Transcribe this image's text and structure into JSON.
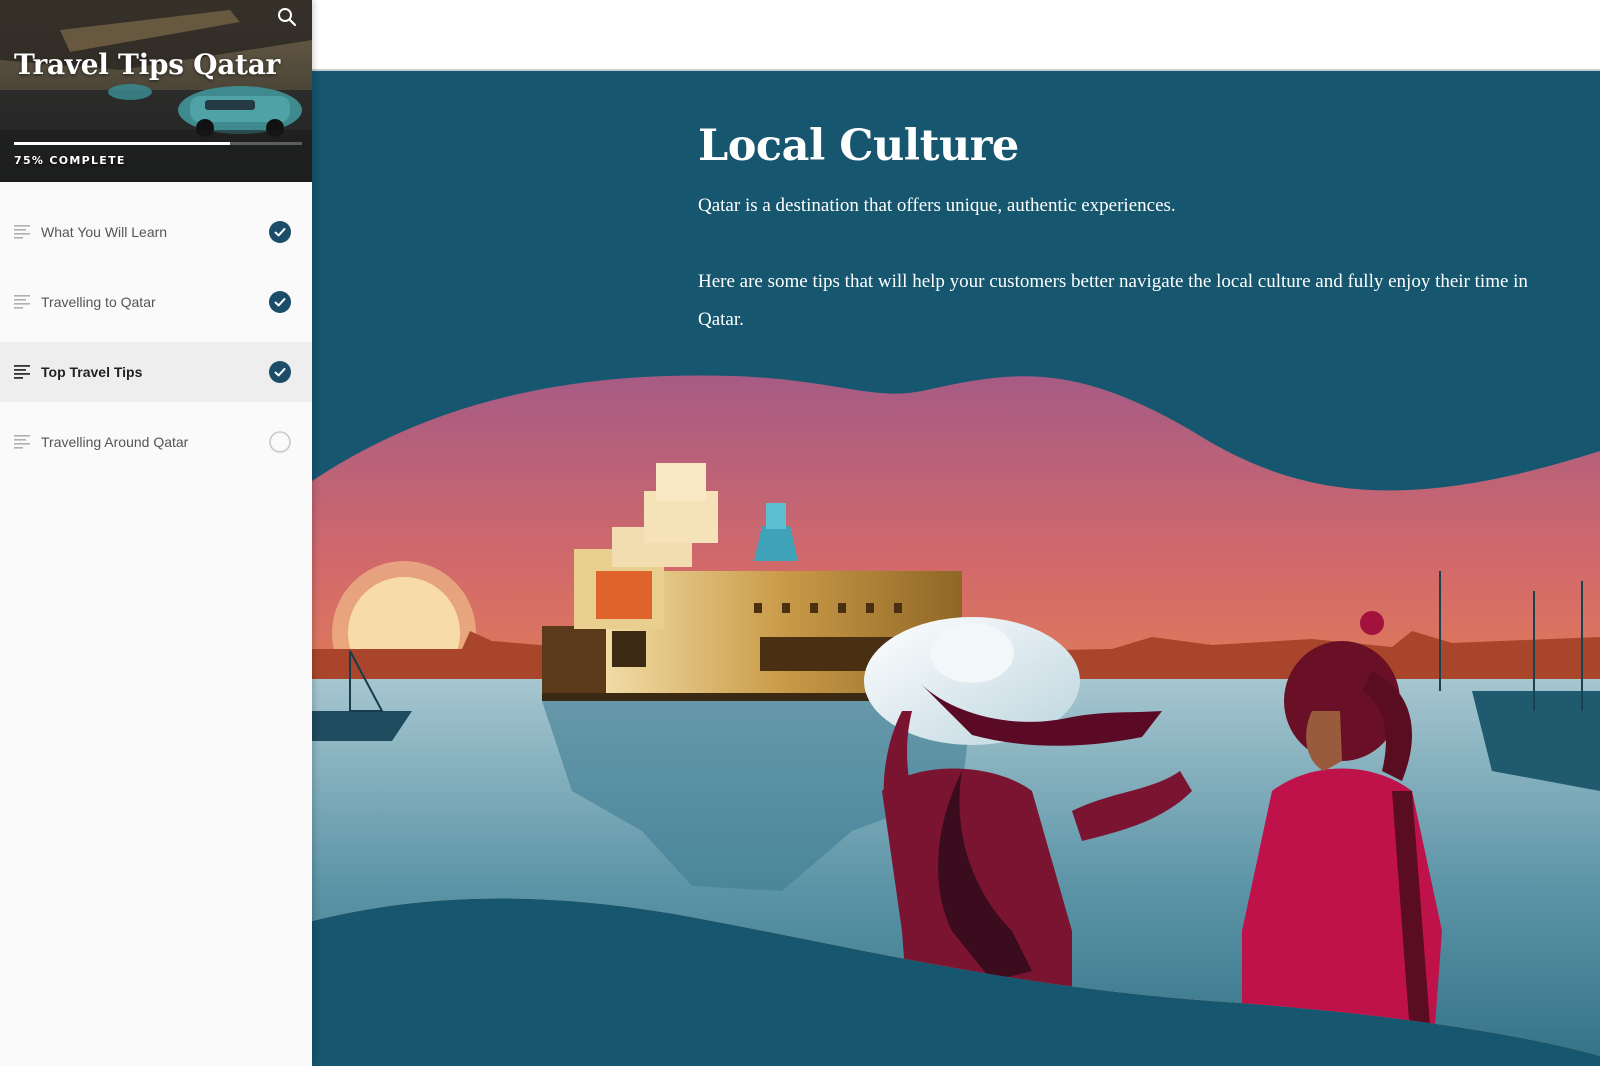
{
  "course": {
    "title": "Travel Tips Qatar",
    "progress_percent": 75,
    "progress_label": "75% COMPLETE",
    "search_icon": "search-icon"
  },
  "lessons": [
    {
      "label": "What You Will Learn",
      "status": "complete",
      "active": false
    },
    {
      "label": "Travelling to Qatar",
      "status": "complete",
      "active": false
    },
    {
      "label": "Top Travel Tips",
      "status": "complete",
      "active": true
    },
    {
      "label": "Travelling Around Qatar",
      "status": "incomplete",
      "active": false
    }
  ],
  "lesson_icon": "lesson-lines-icon",
  "content": {
    "heading": "Local Culture",
    "intro": "Qatar is a destination that offers unique, authentic experiences.",
    "tips": "Here are some tips that will help your customers better navigate the local culture and fully enjoy their time in Qatar."
  },
  "colors": {
    "banner_blue": "#16566f",
    "check_fill": "#1b4d68",
    "accent_crimson": "#9b1540",
    "sunset_orange": "#e98a4a"
  }
}
